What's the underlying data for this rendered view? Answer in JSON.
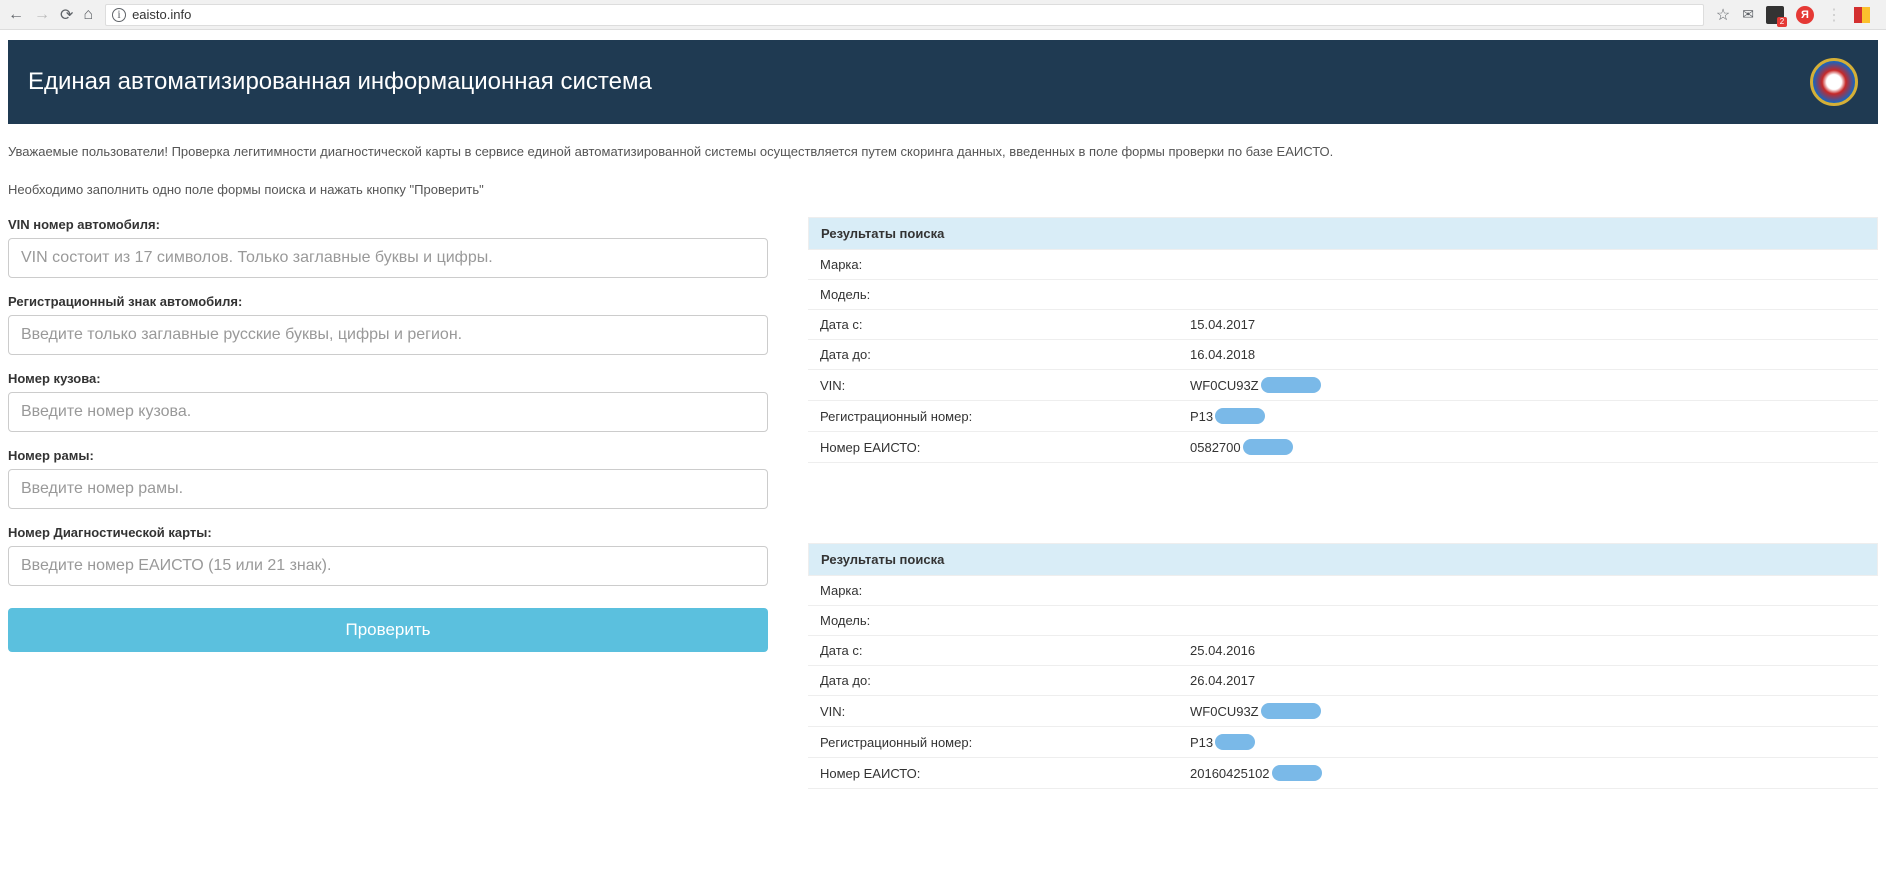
{
  "browser": {
    "url": "eaisto.info"
  },
  "header": {
    "title": "Единая автоматизированная информационная система"
  },
  "intro": {
    "line1": "Уважаемые пользователи! Проверка легитимности диагностической карты в сервисе единой автоматизированной системы осуществляется путем скоринга данных, введенных в поле формы проверки по базе ЕАИСТО.",
    "line2": "Необходимо заполнить одно поле формы поиска и нажать кнопку \"Проверить\""
  },
  "form": {
    "vin": {
      "label": "VIN номер автомобиля:",
      "placeholder": "VIN состоит из 17 символов. Только заглавные буквы и цифры."
    },
    "regplate": {
      "label": "Регистрационный знак автомобиля:",
      "placeholder": "Введите только заглавные русские буквы, цифры и регион."
    },
    "body": {
      "label": "Номер кузова:",
      "placeholder": "Введите номер кузова."
    },
    "frame": {
      "label": "Номер рамы:",
      "placeholder": "Введите номер рамы."
    },
    "diagcard": {
      "label": "Номер Диагностической карты:",
      "placeholder": "Введите номер ЕАИСТО (15 или 21 знак)."
    },
    "submit": "Проверить"
  },
  "results": {
    "header": "Результаты поиска",
    "labels": {
      "brand": "Марка:",
      "model": "Модель:",
      "date_from": "Дата с:",
      "date_to": "Дата до:",
      "vin": "VIN:",
      "reg": "Регистрационный номер:",
      "eaisto": "Номер ЕАИСТО:"
    },
    "block1": {
      "brand": "",
      "model": "",
      "date_from": "15.04.2017",
      "date_to": "16.04.2018",
      "vin": "WF0CU93Z",
      "reg": "Р13",
      "eaisto": "0582700"
    },
    "block2": {
      "brand": "",
      "model": "",
      "date_from": "25.04.2016",
      "date_to": "26.04.2017",
      "vin": "WF0CU93Z",
      "reg": "Р13",
      "eaisto": "20160425102"
    }
  }
}
